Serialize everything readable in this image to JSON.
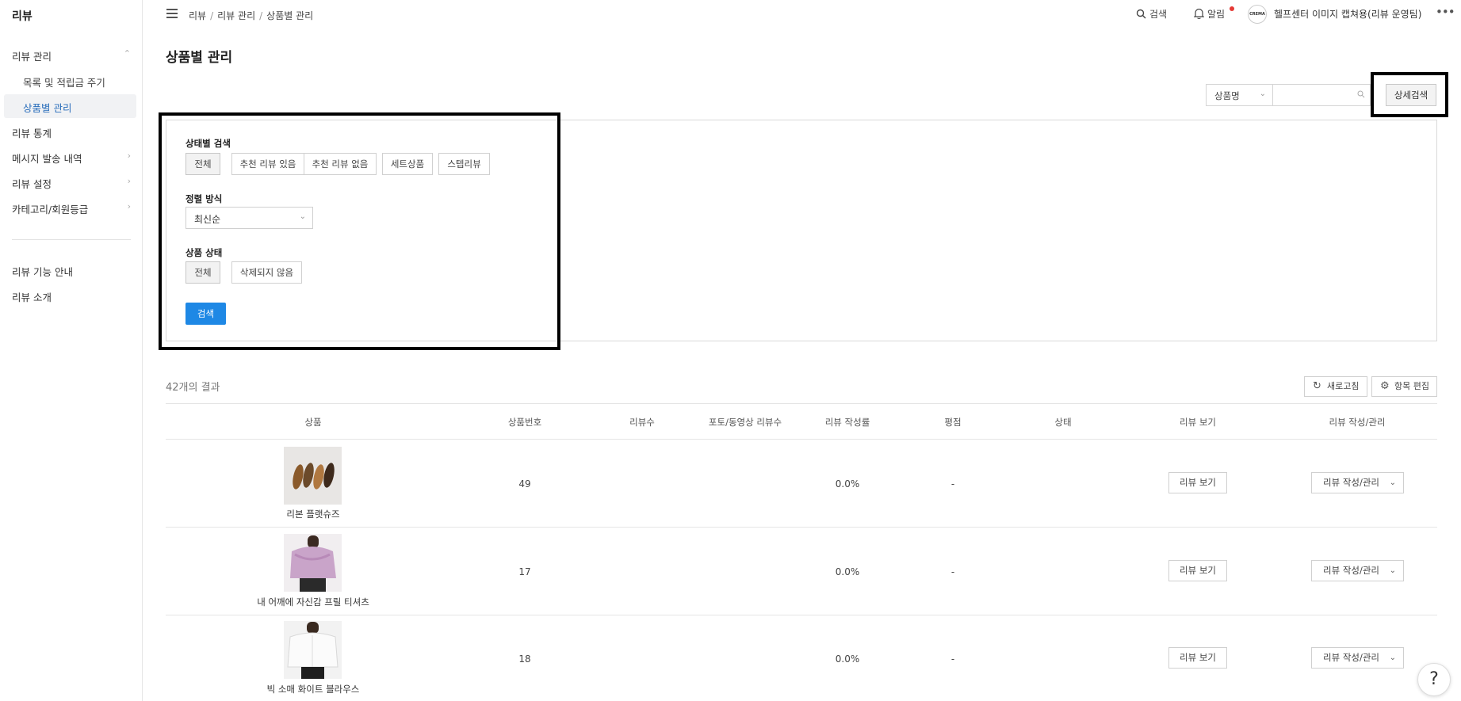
{
  "sidebar": {
    "brand": "리뷰",
    "items": [
      {
        "label": "리뷰 관리"
      },
      {
        "label": "목록 및 적립금 주기"
      },
      {
        "label": "상품별 관리"
      },
      {
        "label": "리뷰 통계"
      },
      {
        "label": "메시지 발송 내역"
      },
      {
        "label": "리뷰 설정"
      },
      {
        "label": "카테고리/회원등급"
      },
      {
        "label": "리뷰 기능 안내"
      },
      {
        "label": "리뷰 소개"
      }
    ]
  },
  "header": {
    "breadcrumb": [
      "리뷰",
      "리뷰 관리",
      "상품별 관리"
    ],
    "search_label": "검색",
    "alarm_label": "알림",
    "avatar_text": "CREMA",
    "user_label": "헬프센터 이미지 캡쳐용(리뷰 운영팀)",
    "more": "•••"
  },
  "main": {
    "title": "상품별 관리",
    "search": {
      "select_value": "상품명",
      "input_value": "",
      "detail_button": "상세검색"
    },
    "panel": {
      "status_label": "상태별 검색",
      "status_chips": [
        "전체",
        "추천 리뷰 있음",
        "추천 리뷰 없음",
        "세트상품",
        "스텝리뷰"
      ],
      "sort_label": "정렬 방식",
      "sort_value": "최신순",
      "product_state_label": "상품 상태",
      "product_state_chips": [
        "전체",
        "삭제되지 않음"
      ],
      "search_button": "검색"
    },
    "result_count": "42개의 결과",
    "refresh_button": "새로고침",
    "edit_columns_button": "항목 편집",
    "table": {
      "headers": [
        "상품",
        "상품번호",
        "리뷰수",
        "포토/동영상 리뷰수",
        "리뷰 작성률",
        "평점",
        "상태",
        "리뷰 보기",
        "리뷰 작성/관리"
      ],
      "rows": [
        {
          "name": "리본 플랫슈즈",
          "id": "49",
          "rate": "0.0%",
          "score": "-",
          "view": "리뷰 보기",
          "manage": "리뷰 작성/관리"
        },
        {
          "name": "내 어깨에 자신감 프릴 티셔츠",
          "id": "17",
          "rate": "0.0%",
          "score": "-",
          "view": "리뷰 보기",
          "manage": "리뷰 작성/관리"
        },
        {
          "name": "빅 소매 화이트 블라우스",
          "id": "18",
          "rate": "0.0%",
          "score": "-",
          "view": "리뷰 보기",
          "manage": "리뷰 작성/관리"
        }
      ]
    },
    "help": "?"
  },
  "colors": {
    "accent": "#1e88e5",
    "active_nav": "#2a6ebb",
    "alarm_dot": "#e53935"
  }
}
